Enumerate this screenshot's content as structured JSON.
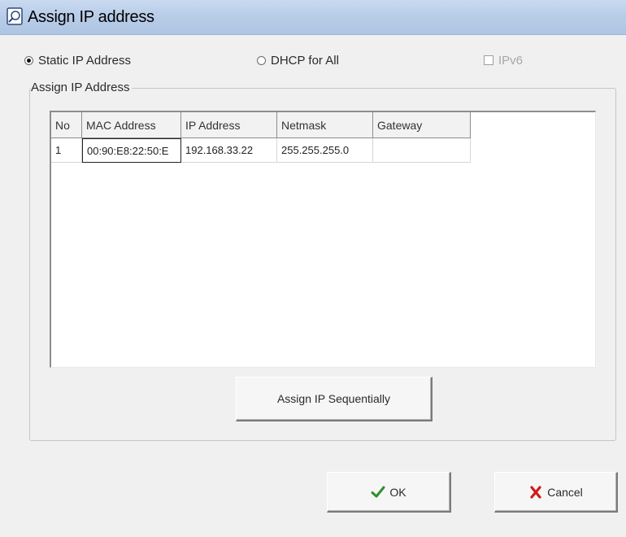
{
  "window": {
    "title": "Assign IP address"
  },
  "mode": {
    "static_label": "Static IP Address",
    "static_selected": true,
    "dhcp_label": "DHCP for All",
    "ipv6_label": "IPv6",
    "ipv6_enabled": false
  },
  "group": {
    "legend": "Assign IP Address"
  },
  "table": {
    "columns": [
      "No",
      "MAC Address",
      "IP Address",
      "Netmask",
      "Gateway"
    ],
    "rows": [
      {
        "no": "1",
        "mac": "00:90:E8:22:50:E",
        "ip": "192.168.33.22",
        "netmask": "255.255.255.0",
        "gateway": ""
      }
    ]
  },
  "buttons": {
    "assign_seq": "Assign IP Sequentially",
    "ok": "OK",
    "cancel": "Cancel"
  },
  "colors": {
    "titlebar": "#b9cde8",
    "ok_check": "#2f8f2f",
    "cancel_x": "#d11a1a"
  },
  "icons": {
    "title": "app-window-icon",
    "ok": "checkmark-icon",
    "cancel": "x-icon"
  }
}
